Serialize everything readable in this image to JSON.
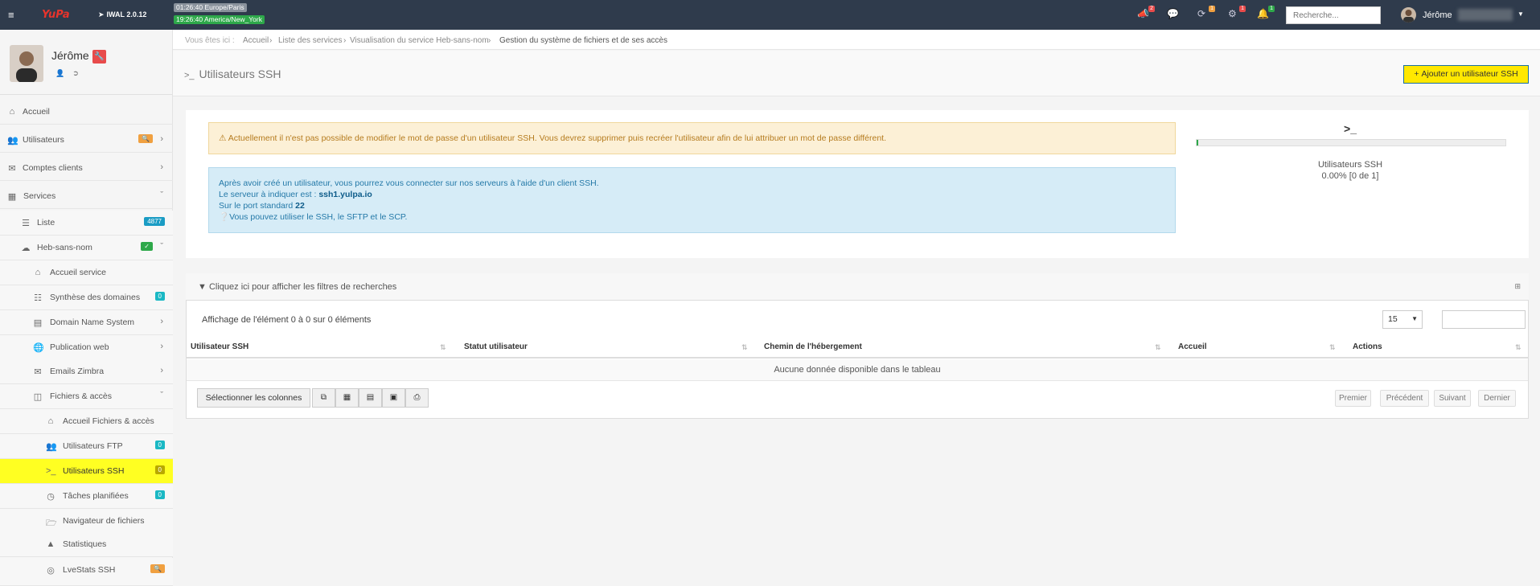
{
  "topbar": {
    "brand": "YuPa",
    "version": "IWAL 2.0.12",
    "clocks": [
      "01:26:40 Europe/Paris",
      "19:26:40 America/New_York"
    ],
    "notif_badges": [
      "2",
      "",
      "1",
      "1",
      "1"
    ],
    "search_placeholder": "Recherche...",
    "user_name": "Jérôme"
  },
  "sidebar": {
    "profile_name": "Jérôme",
    "items": [
      {
        "label": "Accueil"
      },
      {
        "label": "Utilisateurs"
      },
      {
        "label": "Comptes clients"
      },
      {
        "label": "Services"
      },
      {
        "label": "Liste",
        "badge": "4877"
      },
      {
        "label": "Heb-sans-nom"
      },
      {
        "label": "Accueil service"
      },
      {
        "label": "Synthèse des domaines",
        "badge": "0"
      },
      {
        "label": "Domain Name System"
      },
      {
        "label": "Publication web"
      },
      {
        "label": "Emails Zimbra"
      },
      {
        "label": "Fichiers & accès"
      },
      {
        "label": "Accueil Fichiers & accès"
      },
      {
        "label": "Utilisateurs FTP",
        "badge": "0"
      },
      {
        "label": "Utilisateurs SSH",
        "badge": "0"
      },
      {
        "label": "Tâches planifiées",
        "badge": "0"
      },
      {
        "label": "Navigateur de fichiers"
      },
      {
        "label": "Statistiques"
      },
      {
        "label": "LveStats SSH"
      }
    ]
  },
  "breadcrumb": {
    "prefix": "Vous êtes ici :",
    "items": [
      "Accueil",
      "Liste des services",
      "Visualisation du service Heb-sans-nom",
      "Gestion du système de fichiers et de ses accès"
    ]
  },
  "page": {
    "title": "Utilisateurs SSH",
    "add_button": "Ajouter un utilisateur SSH"
  },
  "alerts": {
    "warning": "Actuellement il n'est pas possible de modifier le mot de passe d'un utilisateur SSH. Vous devrez supprimer puis recréer l'utilisateur afin de lui attribuer un mot de passe différent.",
    "info_line1": "Après avoir créé un utilisateur, vous pourrez vous connecter sur nos serveurs à l'aide d'un client SSH.",
    "info_line2_prefix": "Le serveur à indiquer est :",
    "info_server": "ssh1.yulpa.io",
    "info_line3_prefix": "Sur le port standard",
    "info_port": "22",
    "info_line4": "Vous pouvez utiliser le SSH, le SFTP et le SCP."
  },
  "stat": {
    "icon": ">_",
    "label": "Utilisateurs SSH",
    "value": "0.00% [0 de 1]",
    "progress_percent": 0
  },
  "table": {
    "filter_toggle": "Cliquez ici pour afficher les filtres de recherches",
    "info": "Affichage de l'élément 0 à 0 sur 0 éléments",
    "page_length": "15",
    "columns": [
      "Utilisateur SSH",
      "Statut utilisateur",
      "Chemin de l'hébergement",
      "Accueil",
      "Actions"
    ],
    "empty": "Aucune donnée disponible dans le tableau",
    "select_columns": "Sélectionner les colonnes",
    "pagination": [
      "Premier",
      "Précédent",
      "Suivant",
      "Dernier"
    ]
  },
  "colors": {
    "topbar": "#2f3b4c",
    "highlight": "#ffff22",
    "success": "#2ea84a",
    "info_badge": "#1a9cc4",
    "warn_badge": "#f0a040",
    "danger": "#e84b4b"
  }
}
